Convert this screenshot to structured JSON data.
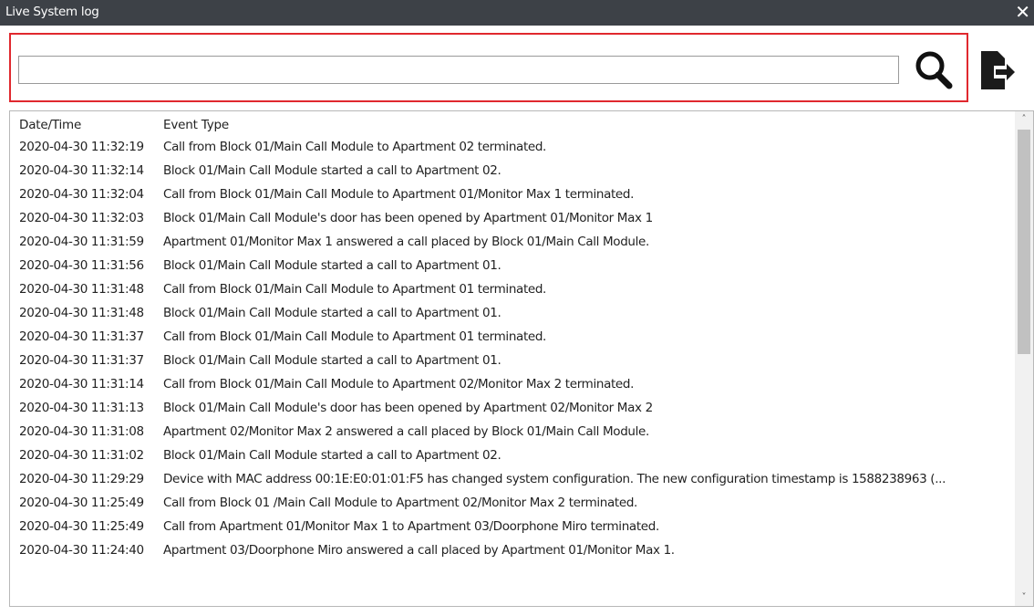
{
  "window": {
    "title": "Live System log",
    "close_glyph": "✕"
  },
  "search": {
    "value": "",
    "search_icon": "search-icon",
    "export_icon": "export-file-icon"
  },
  "table": {
    "columns": [
      "Date/Time",
      "Event Type"
    ],
    "rows": [
      {
        "datetime": "2020-04-30 11:32:19",
        "event": "Call from Block 01/Main Call Module to Apartment 02 terminated."
      },
      {
        "datetime": "2020-04-30 11:32:14",
        "event": "Block 01/Main Call Module started a call to Apartment 02."
      },
      {
        "datetime": "2020-04-30 11:32:04",
        "event": "Call from Block 01/Main Call Module to Apartment 01/Monitor Max 1 terminated."
      },
      {
        "datetime": "2020-04-30 11:32:03",
        "event": "Block 01/Main Call Module's door has been opened by Apartment 01/Monitor Max 1"
      },
      {
        "datetime": "2020-04-30 11:31:59",
        "event": "Apartment 01/Monitor Max 1 answered a call placed by Block 01/Main Call Module."
      },
      {
        "datetime": "2020-04-30 11:31:56",
        "event": "Block 01/Main Call Module started a call to Apartment 01."
      },
      {
        "datetime": "2020-04-30 11:31:48",
        "event": "Call from Block 01/Main Call Module to Apartment 01 terminated."
      },
      {
        "datetime": "2020-04-30 11:31:48",
        "event": "Block 01/Main Call Module started a call to Apartment 01."
      },
      {
        "datetime": "2020-04-30 11:31:37",
        "event": "Call from Block 01/Main Call Module to Apartment 01 terminated."
      },
      {
        "datetime": "2020-04-30 11:31:37",
        "event": "Block 01/Main Call Module started a call to Apartment 01."
      },
      {
        "datetime": "2020-04-30 11:31:14",
        "event": "Call from Block 01/Main Call Module to Apartment 02/Monitor Max 2 terminated."
      },
      {
        "datetime": "2020-04-30 11:31:13",
        "event": "Block 01/Main Call Module's door has been opened by Apartment 02/Monitor Max 2"
      },
      {
        "datetime": "2020-04-30 11:31:08",
        "event": "Apartment 02/Monitor Max 2 answered a call placed by Block 01/Main Call Module."
      },
      {
        "datetime": "2020-04-30 11:31:02",
        "event": "Block 01/Main Call Module started a call to Apartment 02."
      },
      {
        "datetime": "2020-04-30 11:29:29",
        "event": "Device with MAC address 00:1E:E0:01:01:F5 has changed system configuration. The new configuration timestamp is 1588238963 (..."
      },
      {
        "datetime": "2020-04-30 11:25:49",
        "event": "Call from  Block 01 /Main Call Module to Apartment 02/Monitor Max 2 terminated."
      },
      {
        "datetime": "2020-04-30 11:25:49",
        "event": "Call from Apartment 01/Monitor Max 1 to Apartment 03/Doorphone Miro terminated."
      },
      {
        "datetime": "2020-04-30 11:24:40",
        "event": "Apartment 03/Doorphone Miro answered a call placed by Apartment 01/Monitor Max 1."
      }
    ]
  },
  "scrollbar": {
    "up_glyph": "˄",
    "down_glyph": "˅"
  }
}
